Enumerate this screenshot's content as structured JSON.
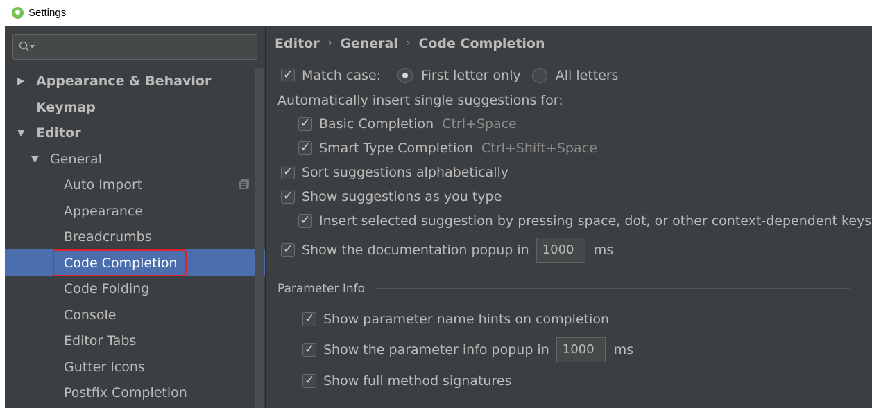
{
  "window": {
    "title": "Settings"
  },
  "search": {
    "placeholder": ""
  },
  "sidebar": {
    "items": [
      {
        "label": "Appearance & Behavior"
      },
      {
        "label": "Keymap"
      },
      {
        "label": "Editor"
      },
      {
        "label": "General"
      },
      {
        "label": "Auto Import"
      },
      {
        "label": "Appearance"
      },
      {
        "label": "Breadcrumbs"
      },
      {
        "label": "Code Completion"
      },
      {
        "label": "Code Folding"
      },
      {
        "label": "Console"
      },
      {
        "label": "Editor Tabs"
      },
      {
        "label": "Gutter Icons"
      },
      {
        "label": "Postfix Completion"
      }
    ],
    "selected": "Code Completion"
  },
  "breadcrumb": {
    "items": [
      "Editor",
      "General",
      "Code Completion"
    ],
    "separator": "›"
  },
  "main": {
    "match_case": {
      "label": "Match case:",
      "checked": true
    },
    "radio_first": {
      "label": "First letter only",
      "selected": true
    },
    "radio_all": {
      "label": "All letters",
      "selected": false
    },
    "auto_insert_label": "Automatically insert single suggestions for:",
    "basic_completion": {
      "label": "Basic Completion",
      "shortcut": "Ctrl+Space",
      "checked": true
    },
    "smart_completion": {
      "label": "Smart Type Completion",
      "shortcut": "Ctrl+Shift+Space",
      "checked": true
    },
    "sort_alpha": {
      "label": "Sort suggestions alphabetically",
      "checked": true
    },
    "show_as_type": {
      "label": "Show suggestions as you type",
      "checked": true
    },
    "insert_selected": {
      "label": "Insert selected suggestion by pressing space, dot, or other context-dependent keys",
      "checked": true
    },
    "doc_popup": {
      "label": "Show the documentation popup in",
      "value": "1000",
      "unit": "ms",
      "checked": true
    }
  },
  "parameter_info": {
    "title": "Parameter Info",
    "name_hints": {
      "label": "Show parameter name hints on completion",
      "checked": true
    },
    "info_popup": {
      "label": "Show the parameter info popup in",
      "value": "1000",
      "unit": "ms",
      "checked": true
    },
    "full_signatures": {
      "label": "Show full method signatures",
      "checked": true
    }
  },
  "colors": {
    "background": "#3c3f41",
    "selection": "#4b6eaf",
    "highlight_border": "#e0202a",
    "text": "#bbbbbb",
    "shortcut_text": "#8c8c8c"
  }
}
